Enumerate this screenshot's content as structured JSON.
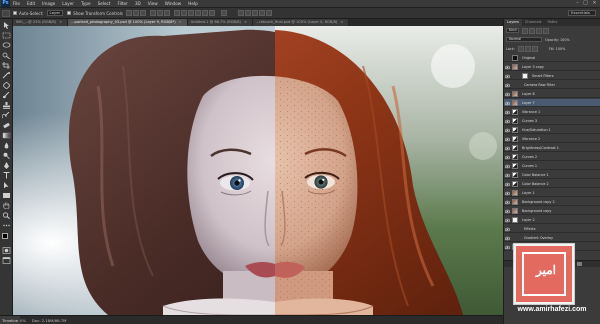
{
  "app": {
    "logo": "Ps",
    "menu": [
      "File",
      "Edit",
      "Image",
      "Layer",
      "Type",
      "Select",
      "Filter",
      "3D",
      "View",
      "Window",
      "Help"
    ],
    "window_controls": [
      "minimize-icon",
      "maximize-icon",
      "close-icon"
    ]
  },
  "options_bar": {
    "auto_select_label": "Auto-Select:",
    "auto_select_value": "Layer",
    "show_transform_label": "Show Transform Controls",
    "workspace": "Essentials"
  },
  "tabs": [
    {
      "label": "IMG_...@ 25% (RGB/8)",
      "active": false
    },
    {
      "label": "...portrait_photography_03.psd @ 100% (Layer 9, RGB/8*)",
      "active": true
    },
    {
      "label": "Untitled-1 @ 66.7% (RGB/8)",
      "active": false
    },
    {
      "label": "...retouch_final.psd @ 100% (Layer 0, RGB/8)",
      "active": false
    }
  ],
  "status": {
    "timeline": "Timeline",
    "zoom": "100%",
    "doc": "Doc: 2.18M/86.7M"
  },
  "layers_panel": {
    "tabs": [
      "Layers",
      "Channels",
      "Paths"
    ],
    "kind_label": "Kind",
    "blend_mode": "Normal",
    "opacity_label": "Opacity: 100%",
    "fill_label": "Fill: 100%",
    "lock_label": "Lock:",
    "layers": [
      {
        "name": "Original",
        "type": "mask",
        "visible": false,
        "selected": false
      },
      {
        "name": "Layer 3 copy",
        "type": "photo",
        "visible": true,
        "selected": false
      },
      {
        "name": "Smart Filters",
        "type": "white",
        "visible": true,
        "selected": false,
        "indent": true
      },
      {
        "name": "Camera Raw Filter",
        "type": "none",
        "visible": true,
        "selected": false,
        "indent": true
      },
      {
        "name": "Layer 8",
        "type": "photo",
        "visible": true,
        "selected": false
      },
      {
        "name": "Layer 7",
        "type": "photo",
        "visible": true,
        "selected": true
      },
      {
        "name": "Vibrance 1",
        "type": "adjust",
        "visible": true,
        "selected": false
      },
      {
        "name": "Curves 3",
        "type": "adjust",
        "visible": true,
        "selected": false
      },
      {
        "name": "Hue/Saturation 1",
        "type": "adjust",
        "visible": true,
        "selected": false
      },
      {
        "name": "Vibrance 2",
        "type": "adjust",
        "visible": true,
        "selected": false
      },
      {
        "name": "Brightness/Contrast 1",
        "type": "adjust",
        "visible": true,
        "selected": false
      },
      {
        "name": "Curves 2",
        "type": "adjust",
        "visible": true,
        "selected": false
      },
      {
        "name": "Curves 1",
        "type": "adjust",
        "visible": true,
        "selected": false
      },
      {
        "name": "Color Balance 1",
        "type": "adjust",
        "visible": true,
        "selected": false
      },
      {
        "name": "Color Balance 2",
        "type": "adjust",
        "visible": true,
        "selected": false
      },
      {
        "name": "Layer 1",
        "type": "photo",
        "visible": true,
        "selected": false
      },
      {
        "name": "Background copy 2",
        "type": "photo",
        "visible": true,
        "selected": false
      },
      {
        "name": "Background copy",
        "type": "photo",
        "visible": true,
        "selected": false
      },
      {
        "name": "Layer 2",
        "type": "white",
        "visible": true,
        "selected": false
      },
      {
        "name": "Effects",
        "type": "none",
        "visible": true,
        "selected": false,
        "indent": true
      },
      {
        "name": "Gradient Overlay",
        "type": "none",
        "visible": true,
        "selected": false,
        "indent": true
      },
      {
        "name": "Background",
        "type": "photo",
        "visible": true,
        "selected": false
      }
    ]
  },
  "watermark": {
    "script": "امیر",
    "url": "www.amirhafezi.com"
  }
}
